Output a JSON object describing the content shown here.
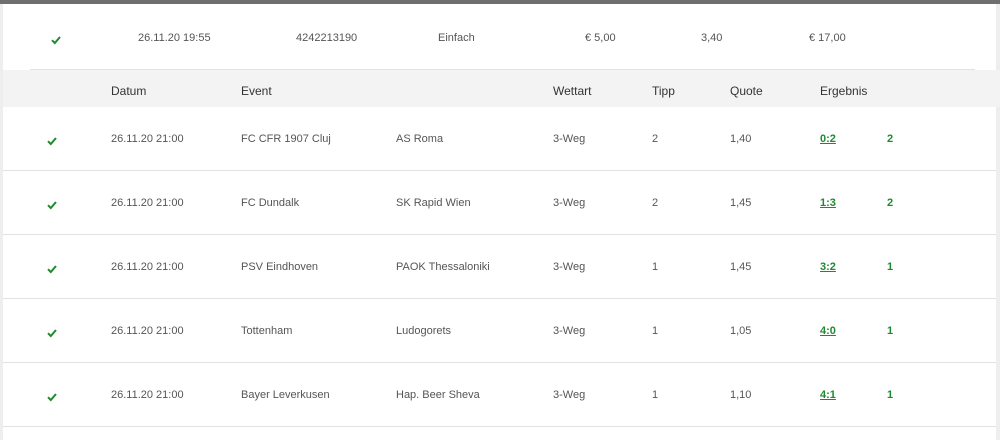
{
  "summary": {
    "date": "26.11.20 19:55",
    "ticket_id": "4242213190",
    "type": "Einfach",
    "stake": "€ 5,00",
    "odds": "3,40",
    "payout": "€ 17,00"
  },
  "columns": {
    "datum": "Datum",
    "event": "Event",
    "wettart": "Wettart",
    "tipp": "Tipp",
    "quote": "Quote",
    "ergebnis": "Ergebnis"
  },
  "rows": [
    {
      "date": "26.11.20 21:00",
      "home": "FC CFR 1907 Cluj",
      "away": "AS Roma",
      "bet_type": "3-Weg",
      "tip": "2",
      "odds": "1,40",
      "score": "0:2",
      "outcome": "2"
    },
    {
      "date": "26.11.20 21:00",
      "home": "FC Dundalk",
      "away": "SK Rapid Wien",
      "bet_type": "3-Weg",
      "tip": "2",
      "odds": "1,45",
      "score": "1:3",
      "outcome": "2"
    },
    {
      "date": "26.11.20 21:00",
      "home": "PSV Eindhoven",
      "away": "PAOK Thessaloniki",
      "bet_type": "3-Weg",
      "tip": "1",
      "odds": "1,45",
      "score": "3:2",
      "outcome": "1"
    },
    {
      "date": "26.11.20 21:00",
      "home": "Tottenham",
      "away": "Ludogorets",
      "bet_type": "3-Weg",
      "tip": "1",
      "odds": "1,05",
      "score": "4:0",
      "outcome": "1"
    },
    {
      "date": "26.11.20 21:00",
      "home": "Bayer Leverkusen",
      "away": "Hap. Beer Sheva",
      "bet_type": "3-Weg",
      "tip": "1",
      "odds": "1,10",
      "score": "4:1",
      "outcome": "1"
    }
  ],
  "icons": {
    "status": "checkmark-icon"
  },
  "colors": {
    "win": "#1e8a2e",
    "header_bg": "#f3f3f3",
    "top_bar": "#6f6f6f"
  }
}
